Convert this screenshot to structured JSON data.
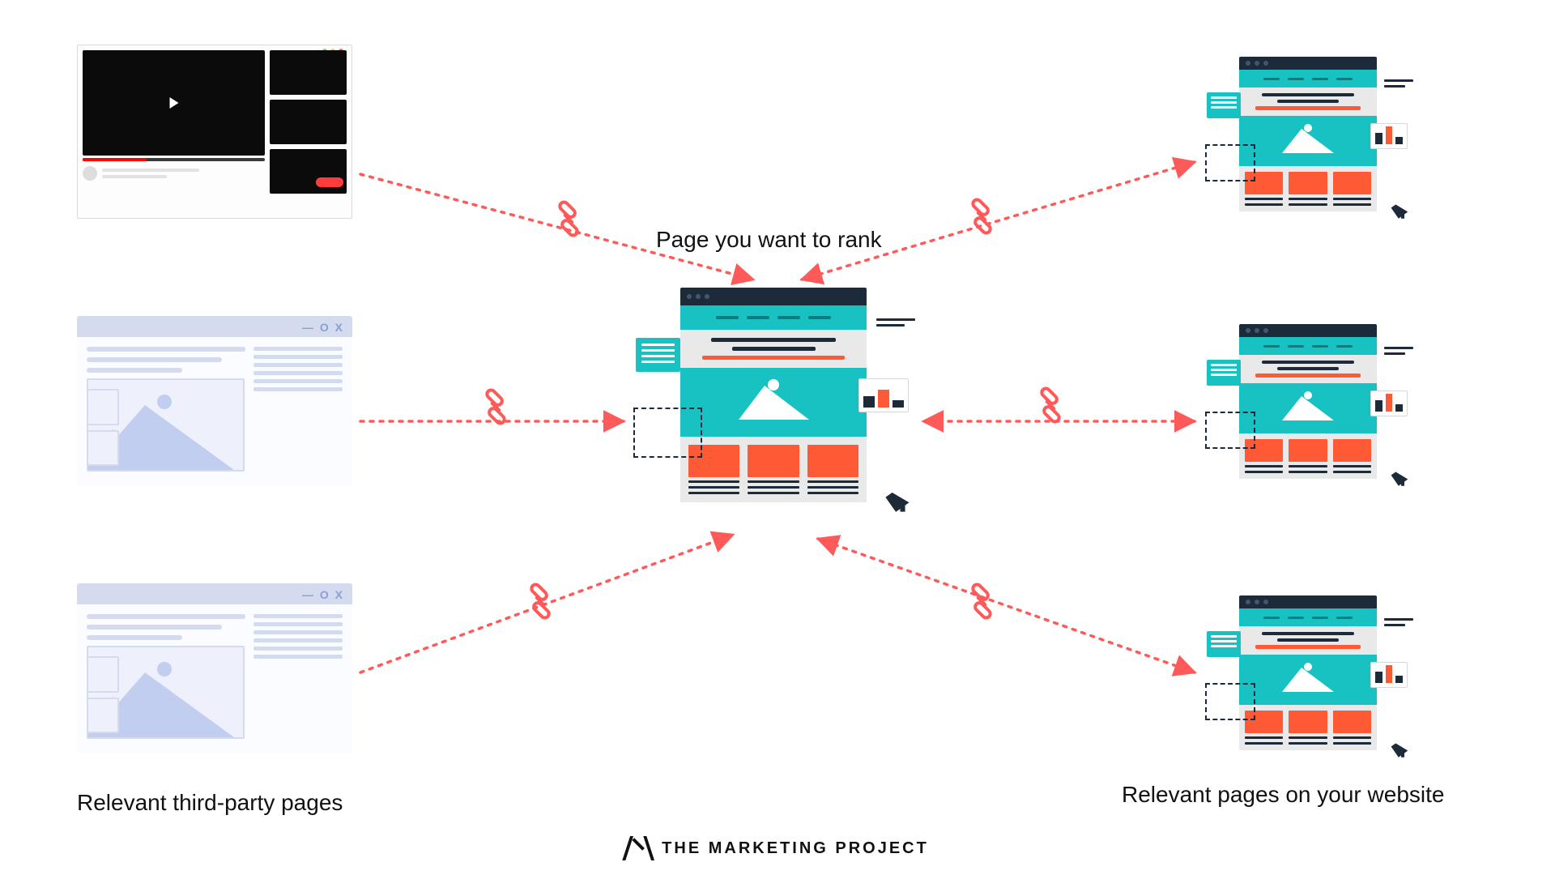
{
  "labels": {
    "center": "Page you want to rank",
    "left_group": "Relevant third-party pages",
    "right_group": "Relevant pages on your website"
  },
  "brand": {
    "text": "THE MARKETING PROJECT"
  },
  "colors": {
    "accent_link": "#ff5a5a",
    "teal": "#18c2c2",
    "orange": "#ff5a36",
    "navy": "#1d2a3a",
    "muted_blue": "#c2cef0"
  },
  "nodes": {
    "left": [
      {
        "kind": "video-page"
      },
      {
        "kind": "blog-page"
      },
      {
        "kind": "blog-page"
      }
    ],
    "center": {
      "kind": "target-page"
    },
    "right": [
      {
        "kind": "site-page"
      },
      {
        "kind": "site-page"
      },
      {
        "kind": "site-page"
      }
    ]
  },
  "links": [
    {
      "from": "left.0",
      "to": "center",
      "bidir": false
    },
    {
      "from": "left.1",
      "to": "center",
      "bidir": false
    },
    {
      "from": "left.2",
      "to": "center",
      "bidir": false
    },
    {
      "from": "right.0",
      "to": "center",
      "bidir": true
    },
    {
      "from": "right.1",
      "to": "center",
      "bidir": true
    },
    {
      "from": "right.2",
      "to": "center",
      "bidir": true
    }
  ]
}
